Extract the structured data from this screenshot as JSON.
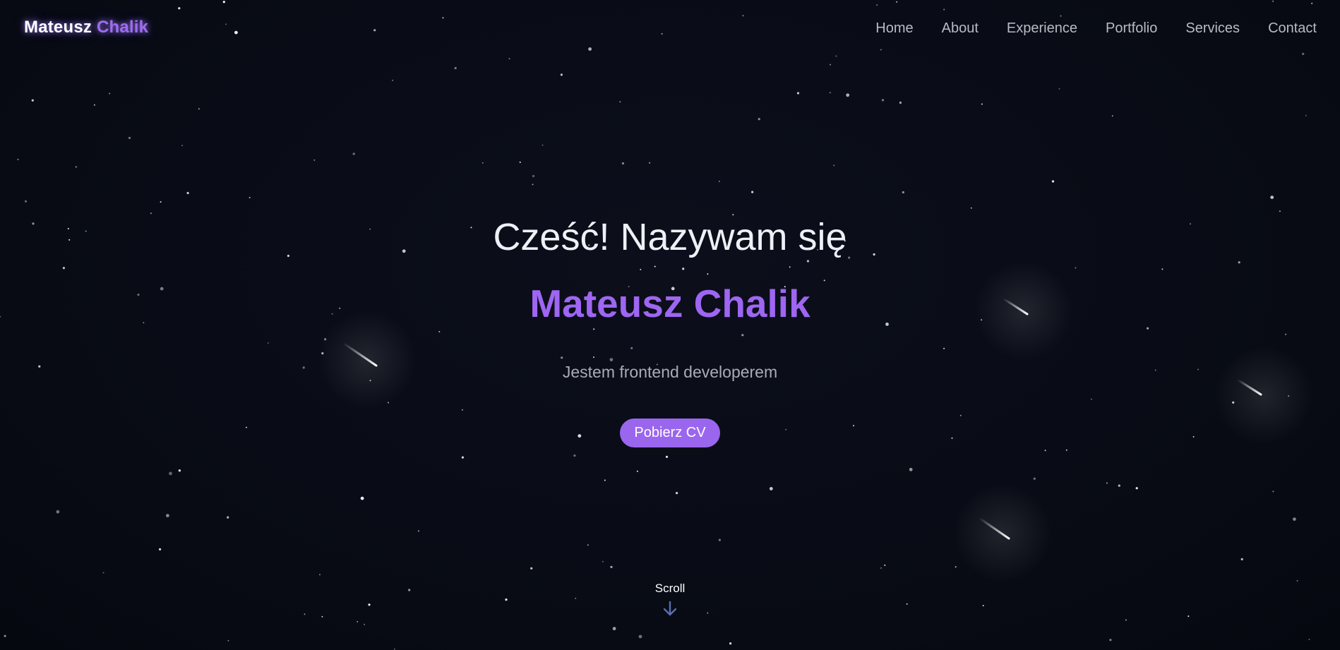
{
  "brand": {
    "first_name": "Mateusz",
    "last_name": "Chalik"
  },
  "nav": {
    "items": [
      {
        "label": "Home"
      },
      {
        "label": "About"
      },
      {
        "label": "Experience"
      },
      {
        "label": "Portfolio"
      },
      {
        "label": "Services"
      },
      {
        "label": "Contact"
      }
    ]
  },
  "hero": {
    "greeting": "Cześć! Nazywam się",
    "name": "Mateusz Chalik",
    "subtitle": "Jestem frontend developerem",
    "cta_label": "Pobierz CV"
  },
  "scroll": {
    "label": "Scroll",
    "icon": "arrow-down-icon"
  },
  "colors": {
    "background": "#080b14",
    "accent": "#9e66f2",
    "text": "#eef0f6",
    "muted": "#a9acb8",
    "scroll_arrow": "#5a6fb0"
  }
}
